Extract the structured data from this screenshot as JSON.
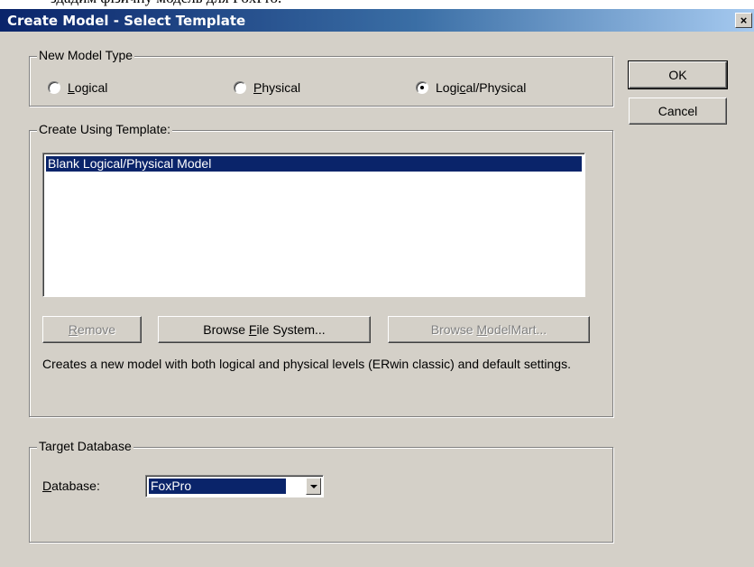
{
  "background_text": "здадим фізичну модель для FoxPro.",
  "window": {
    "title": "Create Model - Select Template",
    "close_glyph": "×"
  },
  "model_type": {
    "legend": "New Model Type",
    "options": [
      {
        "label_pre": "",
        "mnemonic": "L",
        "label_post": "ogical",
        "selected": false
      },
      {
        "label_pre": "",
        "mnemonic": "P",
        "label_post": "hysical",
        "selected": false
      },
      {
        "label_pre": "Logi",
        "mnemonic": "c",
        "label_post": "al/Physical",
        "selected": true
      }
    ]
  },
  "buttons": {
    "ok": "OK",
    "cancel": "Cancel"
  },
  "template": {
    "legend": "Create Using Template:",
    "items": [
      "Blank Logical/Physical Model"
    ],
    "remove": {
      "pre": "",
      "mnemonic": "R",
      "post": "emove"
    },
    "browse_fs": {
      "pre": "Browse ",
      "mnemonic": "F",
      "post": "ile System..."
    },
    "browse_mm": {
      "pre": "Browse ",
      "mnemonic": "M",
      "post": "odelMart..."
    },
    "description": "Creates a new model with both logical and physical levels (ERwin classic) and default settings."
  },
  "target": {
    "legend": "Target Database",
    "label_mnemonic": "D",
    "label_post": "atabase:",
    "value": "FoxPro"
  }
}
